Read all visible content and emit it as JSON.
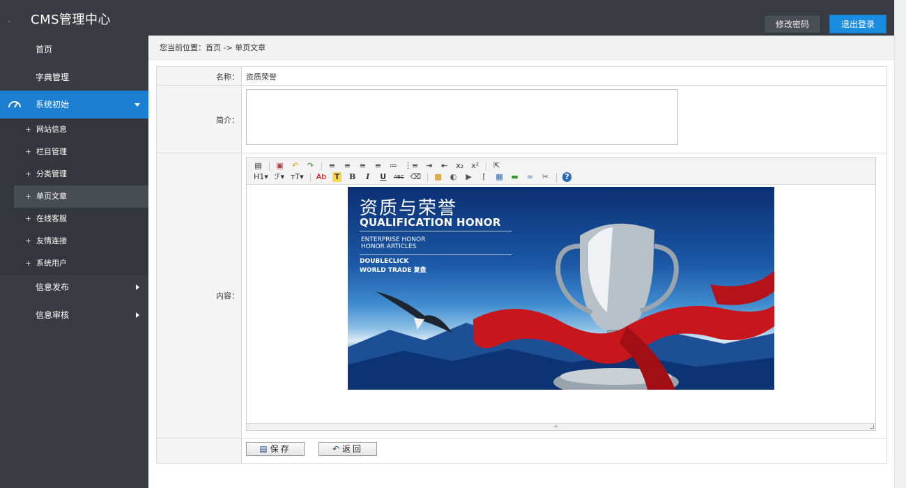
{
  "header": {
    "logo_text": "CMS管理中心",
    "change_password": "修改密码",
    "logout": "退出登录"
  },
  "sidebar": {
    "items": [
      {
        "label": "首页"
      },
      {
        "label": "字典管理"
      },
      {
        "label": "系统初始",
        "active": true,
        "icon": "speedometer-icon"
      },
      {
        "label": "信息发布"
      },
      {
        "label": "信息审核"
      }
    ],
    "sub_items": [
      {
        "label": "网站信息"
      },
      {
        "label": "栏目管理"
      },
      {
        "label": "分类管理"
      },
      {
        "label": "单页文章",
        "selected": true
      },
      {
        "label": "在线客服"
      },
      {
        "label": "友情连接"
      },
      {
        "label": "系统用户"
      }
    ],
    "sub_prefix": "+"
  },
  "breadcrumb": {
    "text": "您当前位置：首页 -> 单页文章"
  },
  "form": {
    "name_label": "名称：",
    "name_value": "资质荣誉",
    "intro_label": "简介：",
    "intro_value": "",
    "content_label": "内容："
  },
  "editor": {
    "toolbar_row1": [
      "source-icon",
      "fullscreen-icon",
      "undo-icon",
      "redo-icon",
      "align-left-icon",
      "align-center-icon",
      "align-right-icon",
      "justify-icon",
      "ordered-list-icon",
      "unordered-list-icon",
      "indent-icon",
      "outdent-icon",
      "subscript-icon",
      "superscript-icon",
      "select-all-icon"
    ],
    "toolbar_row2_text": {
      "heading": "H1",
      "font": "ℱ",
      "font_size": "тT",
      "font_color": "Ab",
      "background_color": "T",
      "bold": "B",
      "italic": "I",
      "underline": "U",
      "strikethrough": "ABC"
    },
    "banner": {
      "title": "资质与荣誉",
      "subtitle": "QUALIFICATION HONOR",
      "line1": "ENTERPRISE HONOR",
      "line2": "HONOR ARTICLES",
      "line3": "DOUBLECLICK",
      "line4": "WORLD TRADE 复盘"
    }
  },
  "buttons": {
    "save": "保存",
    "back": "返回"
  },
  "colors": {
    "header_bg": "#393d43",
    "active_nav": "#1d7fd1",
    "logout_btn": "#1a8ce0"
  }
}
